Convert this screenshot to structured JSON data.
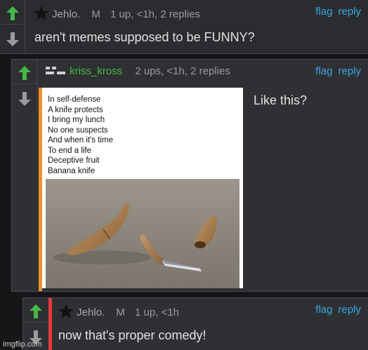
{
  "comments": [
    {
      "username": "Jehlo.",
      "badge": "M",
      "meta": "1 up, <1h, 2 replies",
      "text": "aren't memes supposed to be FUNNY?",
      "flag": "flag",
      "reply": "reply"
    },
    {
      "username": "kriss_kross",
      "meta": "2 ups, <1h, 2 replies",
      "text": "Like this?",
      "flag": "flag",
      "reply": "reply",
      "accent_color": "#f0922b",
      "image": {
        "poem": "In self-defense\nA knife protects\nI bring my lunch\nNo one suspects\nAnd when it's time\nTo end a life\nDeceptive fruit\nBanana knife"
      }
    },
    {
      "username": "Jehlo.",
      "badge": "M",
      "meta": "1 up, <1h",
      "text": "now that's proper comedy!",
      "flag": "flag",
      "reply": "reply",
      "accent_color": "#e23b3b"
    }
  ],
  "icons": [
    "upvote-arrow-icon",
    "downvote-arrow-icon",
    "star-icon",
    "flag-stripe-icon"
  ],
  "colors": {
    "upvote": "#45b848",
    "link": "#37a7e2",
    "green_user": "#45b848"
  },
  "watermark": "imgflip.com"
}
